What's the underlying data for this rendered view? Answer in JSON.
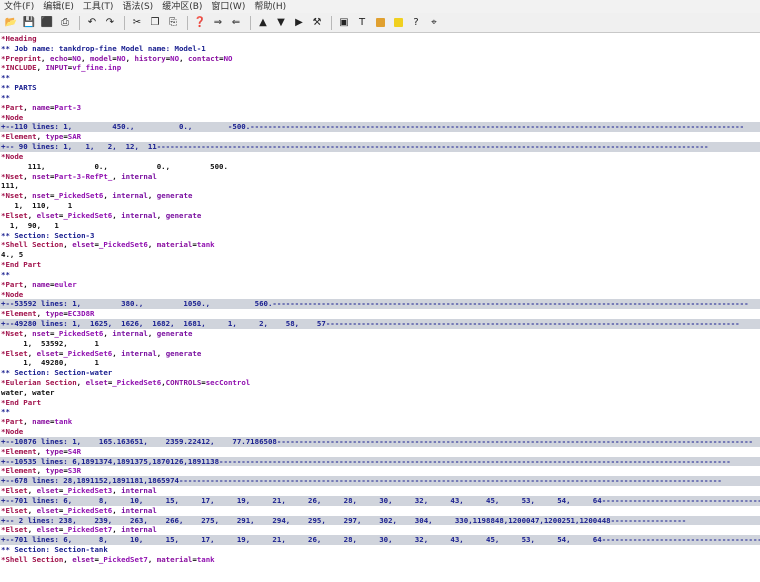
{
  "menu": [
    "文件(F)",
    "编辑(E)",
    "工具(T)",
    "语法(S)",
    "缓冲区(B)",
    "窗口(W)",
    "帮助(H)"
  ],
  "toolbar": {
    "icons": [
      "open-icon",
      "save-icon",
      "save-all-icon",
      "print-icon",
      "undo-icon",
      "redo-icon",
      "cut-icon",
      "copy-icon",
      "paste-icon",
      "find-replace-icon",
      "find-next-icon",
      "find-prev-icon",
      "load-session-icon",
      "save-session-icon",
      "run-script-icon",
      "make-icon",
      "shell-icon",
      "tags-icon",
      "help-icon",
      "find-help-icon"
    ],
    "color_buttons": [
      "#e0a030",
      "#f0d020"
    ]
  },
  "lines": [
    {
      "type": "line",
      "segs": [
        {
          "c": "hd",
          "t": "*Heading"
        }
      ]
    },
    {
      "type": "line",
      "segs": [
        {
          "c": "cm",
          "t": "** Job name: tankdrop-fine Model name: Model-1"
        }
      ]
    },
    {
      "type": "line",
      "segs": [
        {
          "c": "kw",
          "t": "*Preprint"
        },
        {
          "c": "eq",
          "t": ", "
        },
        {
          "c": "pn",
          "t": "echo"
        },
        {
          "c": "eq",
          "t": "="
        },
        {
          "c": "vl",
          "t": "NO"
        },
        {
          "c": "eq",
          "t": ", "
        },
        {
          "c": "pn",
          "t": "model"
        },
        {
          "c": "eq",
          "t": "="
        },
        {
          "c": "vl",
          "t": "NO"
        },
        {
          "c": "eq",
          "t": ", "
        },
        {
          "c": "pn",
          "t": "history"
        },
        {
          "c": "eq",
          "t": "="
        },
        {
          "c": "vl",
          "t": "NO"
        },
        {
          "c": "eq",
          "t": ", "
        },
        {
          "c": "pn",
          "t": "contact"
        },
        {
          "c": "eq",
          "t": "="
        },
        {
          "c": "vl",
          "t": "NO"
        }
      ]
    },
    {
      "type": "line",
      "segs": [
        {
          "c": "kw",
          "t": "*INCLUDE"
        },
        {
          "c": "eq",
          "t": ", "
        },
        {
          "c": "pn",
          "t": "INPUT"
        },
        {
          "c": "eq",
          "t": "="
        },
        {
          "c": "vl",
          "t": "vf_fine.inp"
        }
      ]
    },
    {
      "type": "line",
      "segs": [
        {
          "c": "cm",
          "t": "**"
        }
      ]
    },
    {
      "type": "line",
      "segs": [
        {
          "c": "cm",
          "t": "** PARTS"
        }
      ]
    },
    {
      "type": "line",
      "segs": [
        {
          "c": "cm",
          "t": "**"
        }
      ]
    },
    {
      "type": "line",
      "segs": [
        {
          "c": "kw",
          "t": "*Part"
        },
        {
          "c": "eq",
          "t": ", "
        },
        {
          "c": "pn",
          "t": "name"
        },
        {
          "c": "eq",
          "t": "="
        },
        {
          "c": "vl",
          "t": "Part-3"
        }
      ]
    },
    {
      "type": "line",
      "segs": [
        {
          "c": "kw",
          "t": "*Node"
        }
      ]
    },
    {
      "type": "fold",
      "text": "+--110 lines: 1,         450.,          0.,        -500.---------------------------------------------------------------------------------------------------------------"
    },
    {
      "type": "line",
      "segs": [
        {
          "c": "kw",
          "t": "*Element"
        },
        {
          "c": "eq",
          "t": ", "
        },
        {
          "c": "pn",
          "t": "type"
        },
        {
          "c": "eq",
          "t": "="
        },
        {
          "c": "vl",
          "t": "SAR"
        }
      ]
    },
    {
      "type": "fold",
      "text": "+-- 90 lines: 1,   1,   2,  12,  11----------------------------------------------------------------------------------------------------------------------------"
    },
    {
      "type": "line",
      "segs": [
        {
          "c": "kw",
          "t": "*Node"
        }
      ]
    },
    {
      "type": "line",
      "segs": [
        {
          "c": "nm",
          "t": "      111,           0.,           0.,         500."
        }
      ]
    },
    {
      "type": "line",
      "segs": [
        {
          "c": "kw",
          "t": "*Nset"
        },
        {
          "c": "eq",
          "t": ", "
        },
        {
          "c": "pn",
          "t": "nset"
        },
        {
          "c": "eq",
          "t": "="
        },
        {
          "c": "vl",
          "t": "Part-3-RefPt_"
        },
        {
          "c": "eq",
          "t": ", "
        },
        {
          "c": "vt",
          "t": "internal"
        }
      ]
    },
    {
      "type": "line",
      "segs": [
        {
          "c": "nm",
          "t": "111,"
        }
      ]
    },
    {
      "type": "line",
      "segs": [
        {
          "c": "kw",
          "t": "*Nset"
        },
        {
          "c": "eq",
          "t": ", "
        },
        {
          "c": "pn",
          "t": "nset"
        },
        {
          "c": "eq",
          "t": "="
        },
        {
          "c": "vl",
          "t": "_PickedSet6"
        },
        {
          "c": "eq",
          "t": ", "
        },
        {
          "c": "vt",
          "t": "internal"
        },
        {
          "c": "eq",
          "t": ", "
        },
        {
          "c": "vt",
          "t": "generate"
        }
      ]
    },
    {
      "type": "line",
      "segs": [
        {
          "c": "nm",
          "t": "   1,  110,    1"
        }
      ]
    },
    {
      "type": "line",
      "segs": [
        {
          "c": "kw",
          "t": "*Elset"
        },
        {
          "c": "eq",
          "t": ", "
        },
        {
          "c": "pn",
          "t": "elset"
        },
        {
          "c": "eq",
          "t": "="
        },
        {
          "c": "vl",
          "t": "_PickedSet6"
        },
        {
          "c": "eq",
          "t": ", "
        },
        {
          "c": "vt",
          "t": "internal"
        },
        {
          "c": "eq",
          "t": ", "
        },
        {
          "c": "vt",
          "t": "generate"
        }
      ]
    },
    {
      "type": "line",
      "segs": [
        {
          "c": "nm",
          "t": "  1,  90,   1"
        }
      ]
    },
    {
      "type": "line",
      "segs": [
        {
          "c": "sec",
          "t": "** Section: Section-3"
        }
      ]
    },
    {
      "type": "line",
      "segs": [
        {
          "c": "kw",
          "t": "*Shell Section"
        },
        {
          "c": "eq",
          "t": ", "
        },
        {
          "c": "pn",
          "t": "elset"
        },
        {
          "c": "eq",
          "t": "="
        },
        {
          "c": "vl",
          "t": "_PickedSet6"
        },
        {
          "c": "eq",
          "t": ", "
        },
        {
          "c": "pn",
          "t": "material"
        },
        {
          "c": "eq",
          "t": "="
        },
        {
          "c": "vl",
          "t": "tank"
        }
      ]
    },
    {
      "type": "line",
      "segs": [
        {
          "c": "nm",
          "t": "4., 5"
        }
      ]
    },
    {
      "type": "line",
      "segs": [
        {
          "c": "kw",
          "t": "*End Part"
        }
      ]
    },
    {
      "type": "line",
      "segs": [
        {
          "c": "cm",
          "t": "**"
        }
      ]
    },
    {
      "type": "line",
      "segs": [
        {
          "c": "kw",
          "t": "*Part"
        },
        {
          "c": "eq",
          "t": ", "
        },
        {
          "c": "pn",
          "t": "name"
        },
        {
          "c": "eq",
          "t": "="
        },
        {
          "c": "vl",
          "t": "euler"
        }
      ]
    },
    {
      "type": "line",
      "segs": [
        {
          "c": "kw",
          "t": "*Node"
        }
      ]
    },
    {
      "type": "fold",
      "text": "+--53592 lines: 1,         380.,         1050.,          560.-----------------------------------------------------------------------------------------------------------"
    },
    {
      "type": "line",
      "segs": [
        {
          "c": "kw",
          "t": "*Element"
        },
        {
          "c": "eq",
          "t": ", "
        },
        {
          "c": "pn",
          "t": "type"
        },
        {
          "c": "eq",
          "t": "="
        },
        {
          "c": "vl",
          "t": "EC3D8R"
        }
      ]
    },
    {
      "type": "fold",
      "text": "+--49280 lines: 1,  1625,  1626,  1682,  1681,     1,     2,    58,    57---------------------------------------------------------------------------------------------"
    },
    {
      "type": "line",
      "segs": [
        {
          "c": "kw",
          "t": "*Nset"
        },
        {
          "c": "eq",
          "t": ", "
        },
        {
          "c": "pn",
          "t": "nset"
        },
        {
          "c": "eq",
          "t": "="
        },
        {
          "c": "vl",
          "t": "_PickedSet6"
        },
        {
          "c": "eq",
          "t": ", "
        },
        {
          "c": "vt",
          "t": "internal"
        },
        {
          "c": "eq",
          "t": ", "
        },
        {
          "c": "vt",
          "t": "generate"
        }
      ]
    },
    {
      "type": "line",
      "segs": [
        {
          "c": "nm",
          "t": "     1,  53592,      1"
        }
      ]
    },
    {
      "type": "line",
      "segs": [
        {
          "c": "kw",
          "t": "*Elset"
        },
        {
          "c": "eq",
          "t": ", "
        },
        {
          "c": "pn",
          "t": "elset"
        },
        {
          "c": "eq",
          "t": "="
        },
        {
          "c": "vl",
          "t": "_PickedSet6"
        },
        {
          "c": "eq",
          "t": ", "
        },
        {
          "c": "vt",
          "t": "internal"
        },
        {
          "c": "eq",
          "t": ", "
        },
        {
          "c": "vt",
          "t": "generate"
        }
      ]
    },
    {
      "type": "line",
      "segs": [
        {
          "c": "nm",
          "t": "     1,  49280,      1"
        }
      ]
    },
    {
      "type": "line",
      "segs": [
        {
          "c": "sec",
          "t": "** Section: Section-water"
        }
      ]
    },
    {
      "type": "line",
      "segs": [
        {
          "c": "kw",
          "t": "*Eulerian Section"
        },
        {
          "c": "eq",
          "t": ", "
        },
        {
          "c": "pn",
          "t": "elset"
        },
        {
          "c": "eq",
          "t": "="
        },
        {
          "c": "vl",
          "t": "_PickedSet6"
        },
        {
          "c": "eq",
          "t": ","
        },
        {
          "c": "pn",
          "t": "CONTROLS"
        },
        {
          "c": "eq",
          "t": "="
        },
        {
          "c": "vl",
          "t": "secControl"
        }
      ]
    },
    {
      "type": "line",
      "segs": [
        {
          "c": "nm",
          "t": "water, water"
        }
      ]
    },
    {
      "type": "line",
      "segs": [
        {
          "c": "kw",
          "t": "*End Part"
        }
      ]
    },
    {
      "type": "line",
      "segs": [
        {
          "c": "cm",
          "t": "**"
        }
      ]
    },
    {
      "type": "line",
      "segs": [
        {
          "c": "kw",
          "t": "*Part"
        },
        {
          "c": "eq",
          "t": ", "
        },
        {
          "c": "pn",
          "t": "name"
        },
        {
          "c": "eq",
          "t": "="
        },
        {
          "c": "vl",
          "t": "tank"
        }
      ]
    },
    {
      "type": "line",
      "segs": [
        {
          "c": "kw",
          "t": "*Node"
        }
      ]
    },
    {
      "type": "fold",
      "text": "+--10876 lines: 1,    165.163651,    2359.22412,    77.7186508-----------------------------------------------------------------------------------------------------------"
    },
    {
      "type": "line",
      "segs": [
        {
          "c": "kw",
          "t": "*Element"
        },
        {
          "c": "eq",
          "t": ", "
        },
        {
          "c": "pn",
          "t": "type"
        },
        {
          "c": "eq",
          "t": "="
        },
        {
          "c": "vl",
          "t": "S4R"
        }
      ]
    },
    {
      "type": "fold",
      "text": "+--10535 lines: 6,1891374,1891375,1870126,1891138-------------------------------------------------------------------------------------------------------------------"
    },
    {
      "type": "line",
      "segs": [
        {
          "c": "kw",
          "t": "*Element"
        },
        {
          "c": "eq",
          "t": ", "
        },
        {
          "c": "pn",
          "t": "type"
        },
        {
          "c": "eq",
          "t": "="
        },
        {
          "c": "vl",
          "t": "S3R"
        }
      ]
    },
    {
      "type": "fold",
      "text": "+--678 lines: 28,1891152,1891181,1865974--------------------------------------------------------------------------------------------------------------------------"
    },
    {
      "type": "line",
      "segs": [
        {
          "c": "kw",
          "t": "*Elset"
        },
        {
          "c": "eq",
          "t": ", "
        },
        {
          "c": "pn",
          "t": "elset"
        },
        {
          "c": "eq",
          "t": "="
        },
        {
          "c": "vl",
          "t": "_PickedSet3"
        },
        {
          "c": "eq",
          "t": ", "
        },
        {
          "c": "vt",
          "t": "internal"
        }
      ]
    },
    {
      "type": "fold",
      "text": "+--701 lines: 6,      8,     10,     15,     17,     19,     21,     26,     28,     30,     32,     43,     45,     53,     54,     64--------------------------------------"
    },
    {
      "type": "line",
      "segs": [
        {
          "c": "kw",
          "t": "*Elset"
        },
        {
          "c": "eq",
          "t": ", "
        },
        {
          "c": "pn",
          "t": "elset"
        },
        {
          "c": "eq",
          "t": "="
        },
        {
          "c": "vl",
          "t": "_PickedSet6"
        },
        {
          "c": "eq",
          "t": ", "
        },
        {
          "c": "vt",
          "t": "internal"
        }
      ]
    },
    {
      "type": "fold",
      "text": "+-- 2 lines: 238,    239,    263,    266,    275,    291,    294,    295,    297,    302,    304,     330,1198848,1200047,1200251,1200448-----------------"
    },
    {
      "type": "line",
      "segs": [
        {
          "c": "kw",
          "t": "*Elset"
        },
        {
          "c": "eq",
          "t": ", "
        },
        {
          "c": "pn",
          "t": "elset"
        },
        {
          "c": "eq",
          "t": "="
        },
        {
          "c": "vl",
          "t": "_PickedSet7"
        },
        {
          "c": "eq",
          "t": ", "
        },
        {
          "c": "vt",
          "t": "internal"
        }
      ]
    },
    {
      "type": "fold",
      "text": "+--701 lines: 6,      8,     10,     15,     17,     19,     21,     26,     28,     30,     32,     43,     45,     53,     54,     64--------------------------------------"
    },
    {
      "type": "line",
      "segs": [
        {
          "c": "sec",
          "t": "** Section: Section-tank"
        }
      ]
    },
    {
      "type": "line",
      "segs": [
        {
          "c": "kw",
          "t": "*Shell Section"
        },
        {
          "c": "eq",
          "t": ", "
        },
        {
          "c": "pn",
          "t": "elset"
        },
        {
          "c": "eq",
          "t": "="
        },
        {
          "c": "vl",
          "t": "_PickedSet7"
        },
        {
          "c": "eq",
          "t": ", "
        },
        {
          "c": "pn",
          "t": "material"
        },
        {
          "c": "eq",
          "t": "="
        },
        {
          "c": "vl",
          "t": "tank"
        }
      ]
    }
  ]
}
